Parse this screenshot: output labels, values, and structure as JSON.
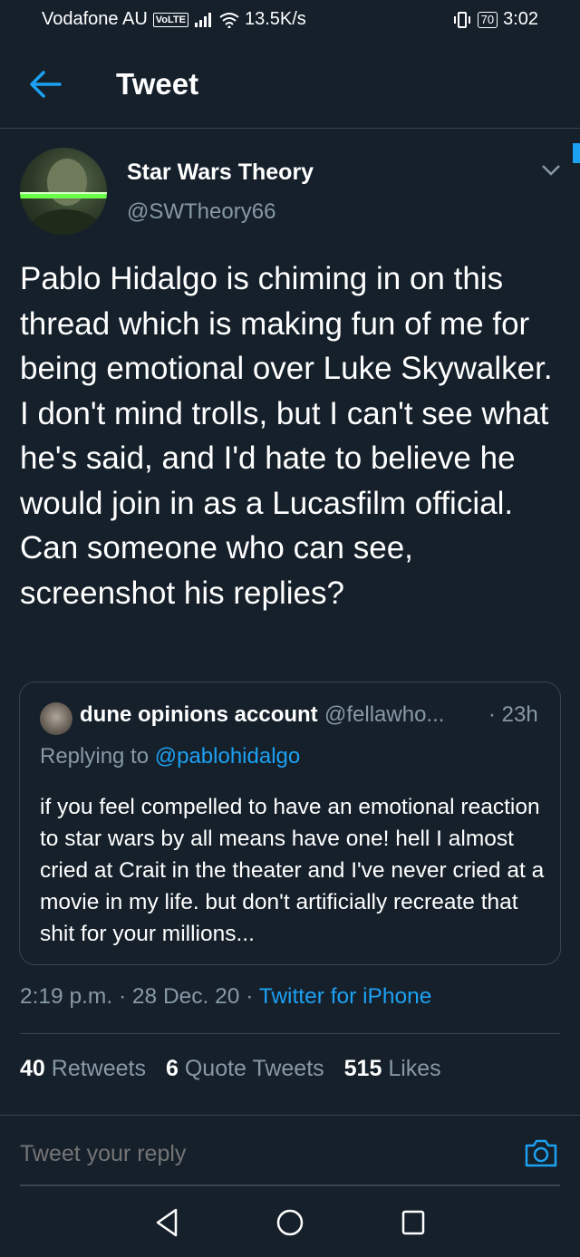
{
  "status_bar": {
    "carrier": "Vodafone AU",
    "volte": "VoLTE",
    "net_speed": "13.5K/s",
    "battery": "70",
    "time": "3:02"
  },
  "header": {
    "title": "Tweet"
  },
  "tweet": {
    "author_name": "Star Wars Theory",
    "author_handle": "@SWTheory66",
    "text": "Pablo Hidalgo is chiming in on this thread which is making fun of me for being emotional over Luke Skywalker. I don't mind trolls, but I can't see what he's said, and I'd hate to believe he would join in as a Lucasfilm official. Can someone who can see, screenshot his replies?",
    "quoted": {
      "name": "dune opinions account",
      "handle": "@fellawho...",
      "time": "· 23h",
      "replying_prefix": "Replying to ",
      "replying_to": "@pablohidalgo",
      "text": "if you feel compelled to have an emotional reaction to star wars by all means have one! hell I almost cried at Crait in the theater and I've never cried at a movie in my life. but don't artificially recreate that shit for your millions..."
    },
    "timestamp": "2:19 p.m. · 28 Dec. 20 · ",
    "source": "Twitter for iPhone",
    "stats": {
      "retweets_count": "40",
      "retweets_label": "Retweets",
      "quotes_count": "6",
      "quotes_label": "Quote Tweets",
      "likes_count": "515",
      "likes_label": "Likes"
    }
  },
  "reply": {
    "placeholder": "Tweet your reply"
  },
  "colors": {
    "background": "#15202b",
    "accent": "#1da1f2",
    "muted": "#8899a6",
    "border": "#38444d"
  }
}
